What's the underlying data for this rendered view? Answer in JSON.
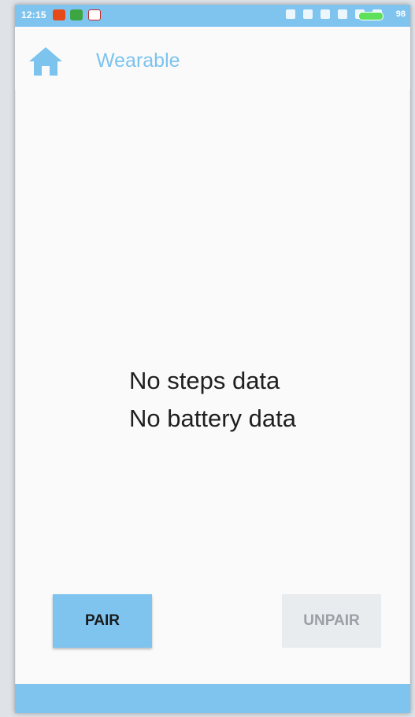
{
  "status_bar": {
    "time": "12:15",
    "battery_percent": "98",
    "icons": [
      "bluetooth-icon",
      "alarm-icon",
      "wifi-icon",
      "signal-icon",
      "data-icon",
      "signal-icon-2"
    ],
    "notifications": [
      "video-app-icon",
      "whatsapp-icon",
      "gmail-icon"
    ]
  },
  "app_bar": {
    "title": "Wearable",
    "home_icon": "home-icon"
  },
  "main": {
    "steps_text": "No steps data",
    "battery_text": "No battery data"
  },
  "actions": {
    "pair_label": "PAIR",
    "unpair_label": "UNPAIR",
    "unpair_enabled": false
  },
  "colors": {
    "accent": "#7fc4ef",
    "title": "#7cc3ee",
    "background": "#fafafa",
    "disabled_button": "#e8ecef",
    "disabled_text": "#9aa0a6"
  }
}
